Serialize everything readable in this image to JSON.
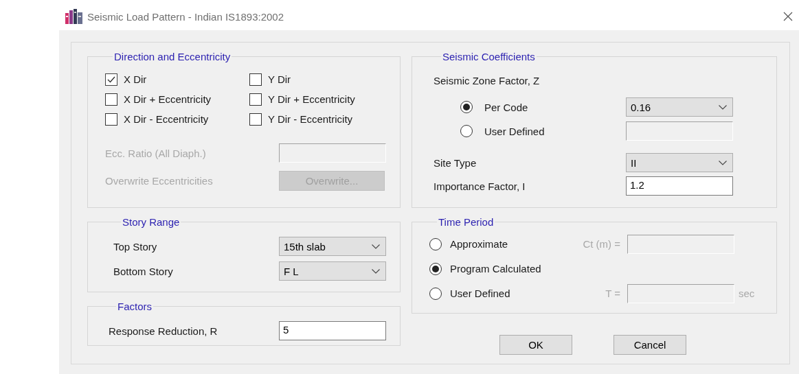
{
  "window": {
    "title": "Seismic Load Pattern - Indian IS1893:2002"
  },
  "direction_and_eccentricity": {
    "title": "Direction and Eccentricity",
    "checkboxes": [
      {
        "label": "X Dir",
        "checked": true
      },
      {
        "label": "Y Dir",
        "checked": false
      },
      {
        "label": "X Dir + Eccentricity",
        "checked": false
      },
      {
        "label": "Y Dir + Eccentricity",
        "checked": false
      },
      {
        "label": "X Dir - Eccentricity",
        "checked": false
      },
      {
        "label": "Y Dir - Eccentricity",
        "checked": false
      }
    ],
    "ecc_ratio": {
      "label": "Ecc. Ratio (All Diaph.)",
      "disabled": true
    },
    "overwrite": {
      "label": "Overwrite Eccentricities",
      "button": "Overwrite...",
      "disabled": true
    }
  },
  "story_range": {
    "title": "Story Range",
    "fields": [
      {
        "label": "Top Story",
        "kind": "dropdown",
        "value": "15th slab"
      },
      {
        "label": "Bottom Story",
        "kind": "dropdown",
        "value": "F L"
      }
    ]
  },
  "factors": {
    "title": "Factors",
    "fields": [
      {
        "label": "Response Reduction, R",
        "value": "5"
      }
    ]
  },
  "seismic_coefficients": {
    "title": "Seismic Coefficients",
    "zone_factor": {
      "label": "Seismic Zone Factor, Z",
      "options": [
        {
          "label": "Per Code",
          "selected": true,
          "field": {
            "kind": "dropdown",
            "value": "0.16"
          }
        },
        {
          "label": "User Defined",
          "selected": false,
          "field": {
            "kind": "text",
            "disabled": true
          }
        }
      ]
    },
    "fields": [
      {
        "label": "Site Type",
        "kind": "dropdown",
        "value": "II"
      },
      {
        "label": "Importance Factor, I",
        "kind": "text",
        "value": "1.2"
      }
    ]
  },
  "time_period": {
    "title": "Time Period",
    "options": [
      {
        "label": "Approximate",
        "selected": false,
        "field": {
          "label": "Ct (m) =",
          "disabled": true
        }
      },
      {
        "label": "Program Calculated",
        "selected": true
      },
      {
        "label": "User Defined",
        "selected": false,
        "field": {
          "label": "T =",
          "unit": "sec",
          "disabled": true
        }
      }
    ]
  },
  "buttons": [
    "OK",
    "Cancel"
  ]
}
